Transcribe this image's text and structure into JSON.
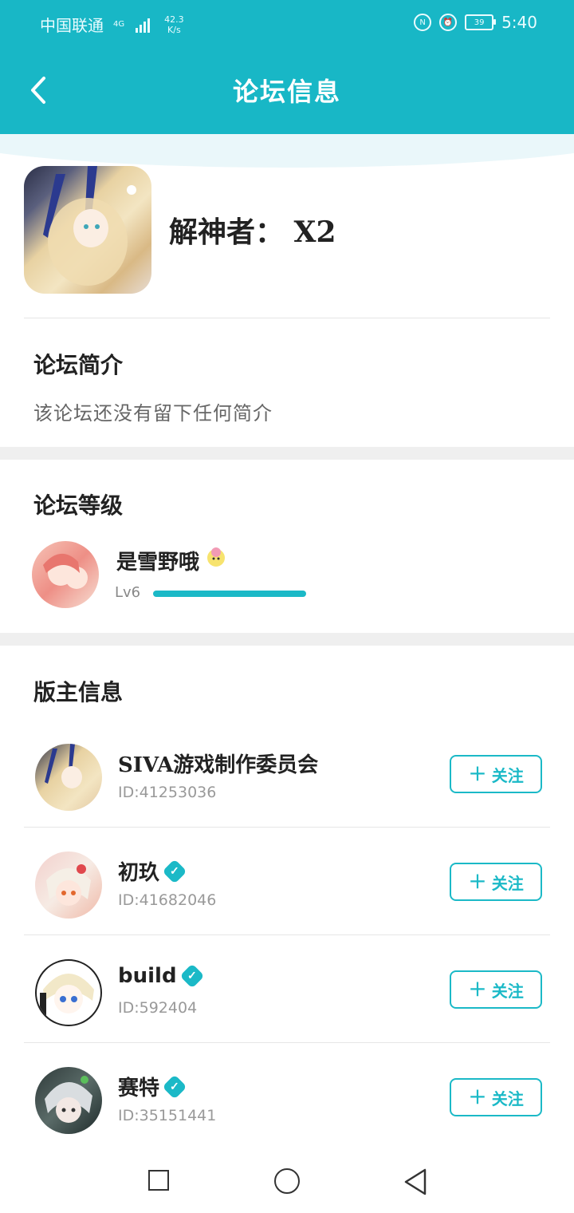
{
  "status": {
    "carrier": "中国联通",
    "net_type": "4G",
    "speed_value": "42.3",
    "speed_unit": "K/s",
    "nfc_label": "N",
    "battery": "39",
    "time": "5:40"
  },
  "nav": {
    "title": "论坛信息"
  },
  "forum": {
    "name": "解神者： X2"
  },
  "intro": {
    "title": "论坛简介",
    "text": "该论坛还没有留下任何简介"
  },
  "level": {
    "title": "论坛等级",
    "user_name": "是雪野哦",
    "level_label": "Lv6",
    "progress": 1.0
  },
  "moderators": {
    "title": "版主信息",
    "follow_label": "关注",
    "items": [
      {
        "name": "SIVA游戏制作委员会",
        "id": "ID:41253036",
        "verified": false
      },
      {
        "name": "初玖",
        "id": "ID:41682046",
        "verified": true
      },
      {
        "name": "build",
        "id": "ID:592404",
        "verified": true
      },
      {
        "name": "赛特",
        "id": "ID:35151441",
        "verified": true
      }
    ]
  },
  "colors": {
    "accent": "#18b7c6"
  }
}
